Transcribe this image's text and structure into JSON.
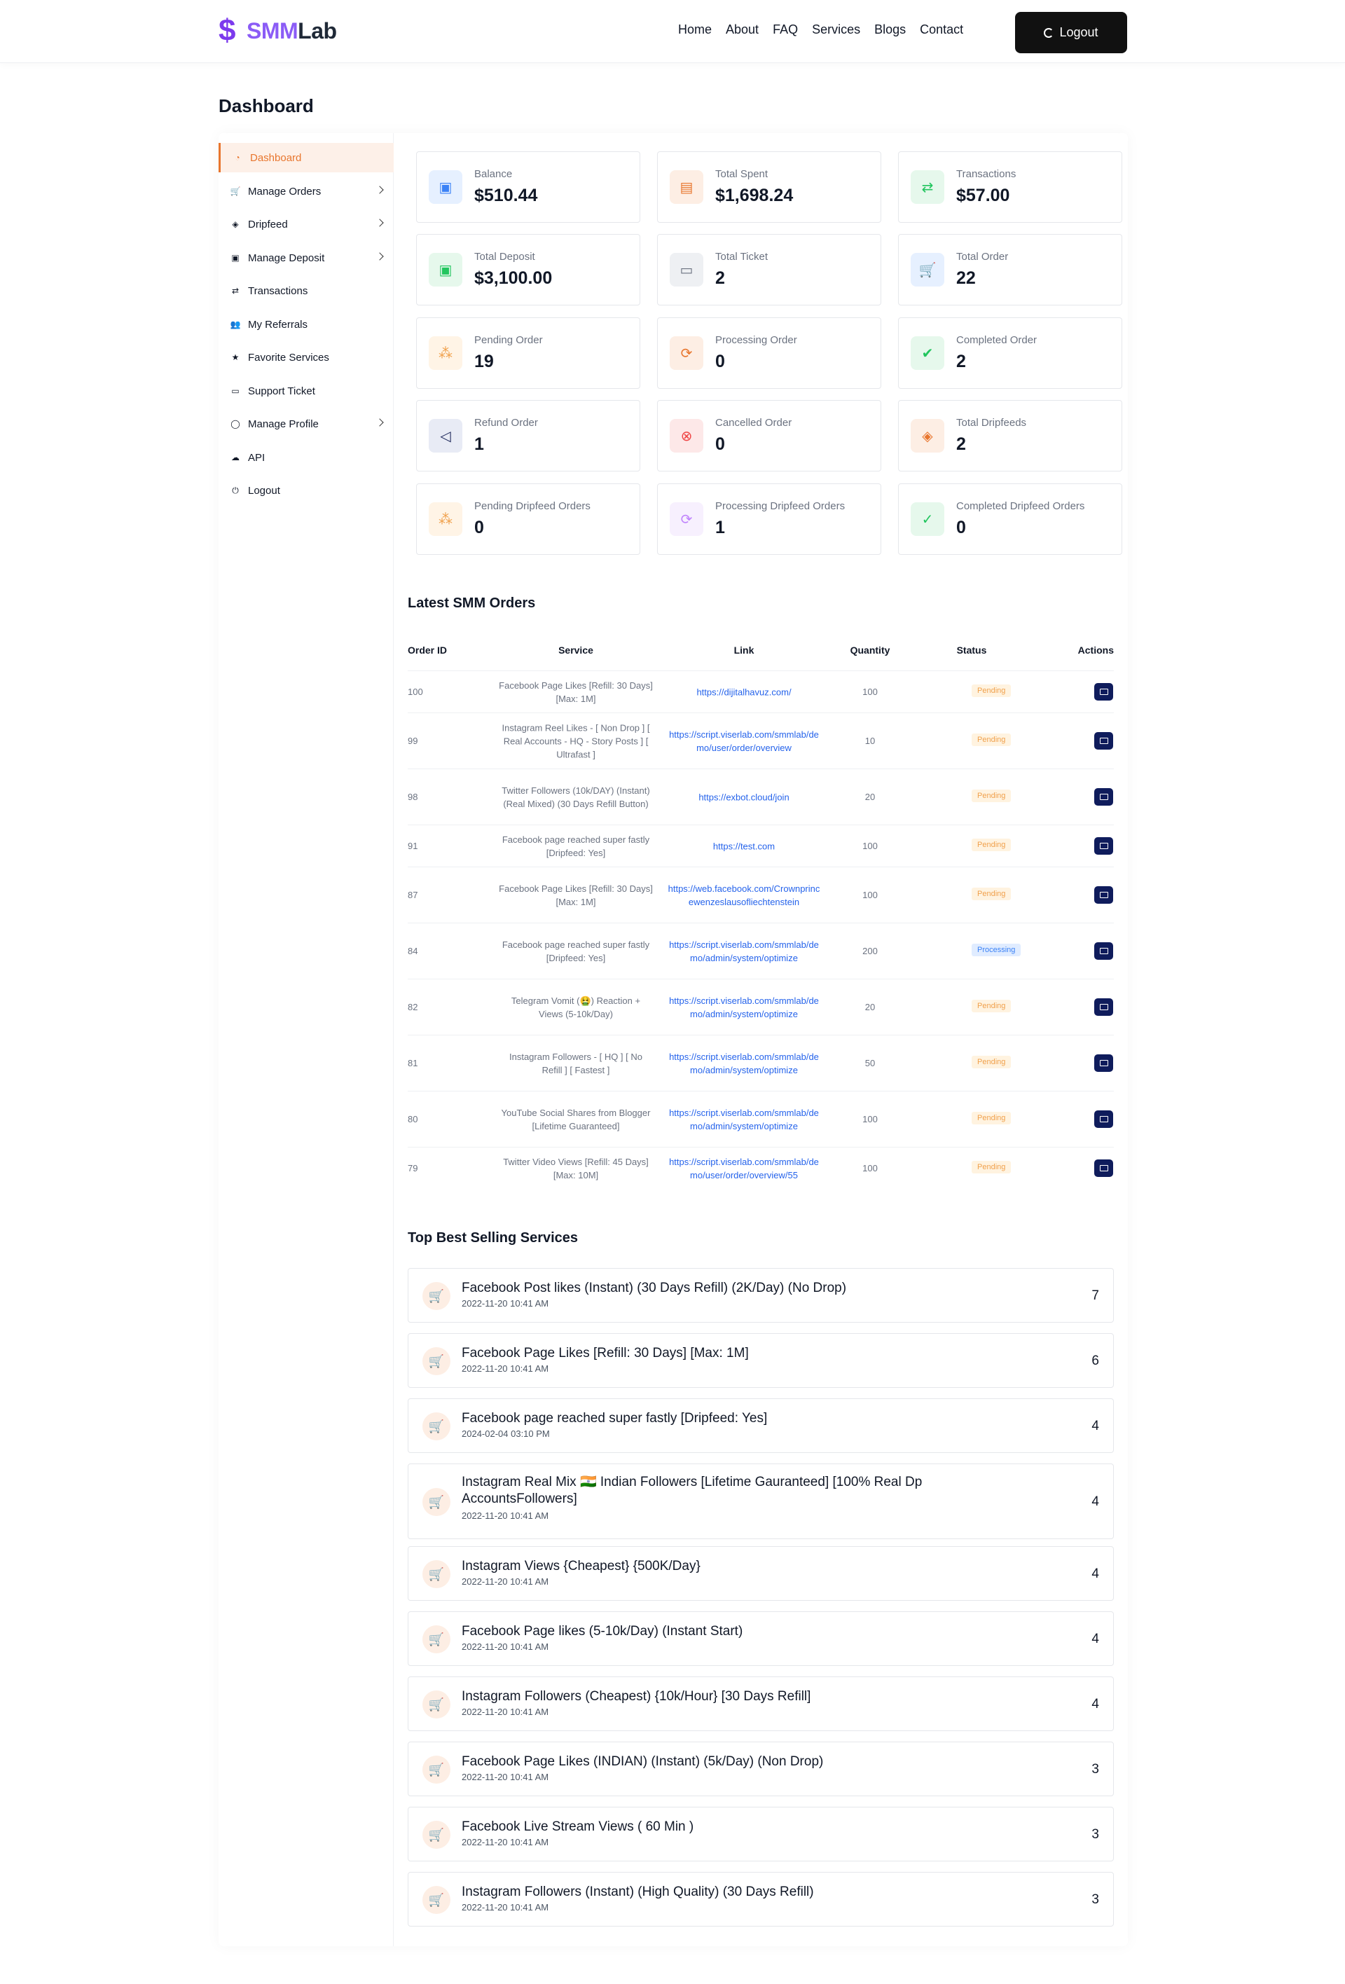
{
  "header": {
    "logo_smm": "SMM",
    "logo_lab": "Lab",
    "nav": [
      "Home",
      "About",
      "FAQ",
      "Services",
      "Blogs",
      "Contact"
    ],
    "logout_label": "Logout"
  },
  "page_title": "Dashboard",
  "sidebar": {
    "items": [
      {
        "label": "Dashboard",
        "icon": "dashboard-icon",
        "chevron": false,
        "active": true
      },
      {
        "label": "Manage Orders",
        "icon": "cart-icon",
        "chevron": true
      },
      {
        "label": "Dripfeed",
        "icon": "paint-bucket-icon",
        "chevron": true
      },
      {
        "label": "Manage Deposit",
        "icon": "wallet-icon",
        "chevron": true
      },
      {
        "label": "Transactions",
        "icon": "transfer-icon",
        "chevron": false
      },
      {
        "label": "My Referrals",
        "icon": "users-icon",
        "chevron": false
      },
      {
        "label": "Favorite Services",
        "icon": "star-icon",
        "chevron": false
      },
      {
        "label": "Support Ticket",
        "icon": "ticket-icon",
        "chevron": false
      },
      {
        "label": "Manage Profile",
        "icon": "user-icon",
        "chevron": true
      },
      {
        "label": "API",
        "icon": "cloud-icon",
        "chevron": false
      },
      {
        "label": "Logout",
        "icon": "logout-icon",
        "chevron": false
      }
    ]
  },
  "stats": [
    {
      "label": "Balance",
      "value": "$510.44",
      "icon": "wallet-icon",
      "color": "#3b82f6",
      "bg": "#e6f0ff"
    },
    {
      "label": "Total Spent",
      "value": "$1,698.24",
      "icon": "money-icon",
      "color": "#e8762e",
      "bg": "#fdeee4"
    },
    {
      "label": "Transactions",
      "value": "$57.00",
      "icon": "transfer-icon",
      "color": "#22c55e",
      "bg": "#e6f8ec"
    },
    {
      "label": "Total Deposit",
      "value": "$3,100.00",
      "icon": "wallet-icon",
      "color": "#22c55e",
      "bg": "#e6f8ec"
    },
    {
      "label": "Total Ticket",
      "value": "2",
      "icon": "ticket-icon",
      "color": "#6b7280",
      "bg": "#eef0f3"
    },
    {
      "label": "Total Order",
      "value": "22",
      "icon": "cart-icon",
      "color": "#3b82f6",
      "bg": "#e6f0ff"
    },
    {
      "label": "Pending Order",
      "value": "19",
      "icon": "spinner-icon",
      "color": "#f0a04b",
      "bg": "#fff4e6"
    },
    {
      "label": "Processing Order",
      "value": "0",
      "icon": "refresh-icon",
      "color": "#e8762e",
      "bg": "#fdeee4"
    },
    {
      "label": "Completed Order",
      "value": "2",
      "icon": "check-circle-icon",
      "color": "#22c55e",
      "bg": "#e6f8ec"
    },
    {
      "label": "Refund Order",
      "value": "1",
      "icon": "rewind-icon",
      "color": "#1f2a5c",
      "bg": "#e8ebf5"
    },
    {
      "label": "Cancelled Order",
      "value": "0",
      "icon": "x-circle-icon",
      "color": "#ef4444",
      "bg": "#fde8e8"
    },
    {
      "label": "Total Dripfeeds",
      "value": "2",
      "icon": "paint-bucket-icon",
      "color": "#e8762e",
      "bg": "#fdeee4"
    },
    {
      "label": "Pending Dripfeed Orders",
      "value": "0",
      "icon": "spinner-icon",
      "color": "#f0a04b",
      "bg": "#fff4e6"
    },
    {
      "label": "Processing Dripfeed Orders",
      "value": "1",
      "icon": "refresh-icon",
      "color": "#c084fc",
      "bg": "#f7f0fe"
    },
    {
      "label": "Completed Dripfeed Orders",
      "value": "0",
      "icon": "check-icon",
      "color": "#22c55e",
      "bg": "#e6f8ec"
    }
  ],
  "orders": {
    "title": "Latest SMM Orders",
    "headers": [
      "Order ID",
      "Service",
      "Link",
      "Quantity",
      "Status",
      "Actions"
    ],
    "rows": [
      {
        "id": "100",
        "service": "Facebook Page Likes [Refill: 30 Days] [Max: 1M]",
        "link": "https://dijitalhavuz.com/",
        "qty": "100",
        "status": "Pending"
      },
      {
        "id": "99",
        "service": "Instagram Reel Likes - [ Non Drop ] [ Real Accounts - HQ - Story Posts ] [ Ultrafast ]",
        "link": "https://script.viserlab.com/smmlab/demo/user/order/overview",
        "qty": "10",
        "status": "Pending"
      },
      {
        "id": "98",
        "service": "Twitter Followers (10k/DAY) (Instant) (Real Mixed) (30 Days Refill Button)",
        "link": "https://exbot.cloud/join",
        "qty": "20",
        "status": "Pending"
      },
      {
        "id": "91",
        "service": "Facebook page reached super fastly [Dripfeed: Yes]",
        "link": "https://test.com",
        "qty": "100",
        "status": "Pending"
      },
      {
        "id": "87",
        "service": "Facebook Page Likes [Refill: 30 Days] [Max: 1M]",
        "link": "https://web.facebook.com/Crownprincewenzeslausofliechtenstein",
        "qty": "100",
        "status": "Pending"
      },
      {
        "id": "84",
        "service": "Facebook page reached super fastly [Dripfeed: Yes]",
        "link": "https://script.viserlab.com/smmlab/demo/admin/system/optimize",
        "qty": "200",
        "status": "Processing"
      },
      {
        "id": "82",
        "service": "Telegram Vomit (🤮) Reaction + Views (5-10k/Day)",
        "link": "https://script.viserlab.com/smmlab/demo/admin/system/optimize",
        "qty": "20",
        "status": "Pending"
      },
      {
        "id": "81",
        "service": "Instagram Followers - [ HQ ] [ No Refill ] [ Fastest ]",
        "link": "https://script.viserlab.com/smmlab/demo/admin/system/optimize",
        "qty": "50",
        "status": "Pending"
      },
      {
        "id": "80",
        "service": "YouTube Social Shares from Blogger [Lifetime Guaranteed]",
        "link": "https://script.viserlab.com/smmlab/demo/admin/system/optimize",
        "qty": "100",
        "status": "Pending"
      },
      {
        "id": "79",
        "service": "Twitter Video Views [Refill: 45 Days] [Max: 10M]",
        "link": "https://script.viserlab.com/smmlab/demo/user/order/overview/55",
        "qty": "100",
        "status": "Pending"
      }
    ]
  },
  "best_selling": {
    "title": "Top Best Selling Services",
    "items": [
      {
        "name": "Facebook Post likes (Instant) (30 Days Refill) (2K/Day) (No Drop)",
        "date": "2022-11-20 10:41 AM",
        "count": "7"
      },
      {
        "name": "Facebook Page Likes [Refill: 30 Days] [Max: 1M]",
        "date": "2022-11-20 10:41 AM",
        "count": "6"
      },
      {
        "name": "Facebook page reached super fastly [Dripfeed: Yes]",
        "date": "2024-02-04 03:10 PM",
        "count": "4"
      },
      {
        "name": "Instagram Real Mix 🇮🇳 Indian Followers [Lifetime Gauranteed] [100% Real Dp AccountsFollowers]",
        "date": "2022-11-20 10:41 AM",
        "count": "4"
      },
      {
        "name": "Instagram Views {Cheapest} {500K/Day}",
        "date": "2022-11-20 10:41 AM",
        "count": "4"
      },
      {
        "name": "Facebook Page likes (5-10k/Day) (Instant Start)",
        "date": "2022-11-20 10:41 AM",
        "count": "4"
      },
      {
        "name": "Instagram Followers (Cheapest) {10k/Hour} [30 Days Refill]",
        "date": "2022-11-20 10:41 AM",
        "count": "4"
      },
      {
        "name": "Facebook Page Likes (INDIAN) (Instant) (5k/Day) (Non Drop)",
        "date": "2022-11-20 10:41 AM",
        "count": "3"
      },
      {
        "name": "Facebook Live Stream Views ( 60 Min )",
        "date": "2022-11-20 10:41 AM",
        "count": "3"
      },
      {
        "name": "Instagram Followers (Instant) (High Quality) (30 Days Refill)",
        "date": "2022-11-20 10:41 AM",
        "count": "3"
      }
    ]
  }
}
